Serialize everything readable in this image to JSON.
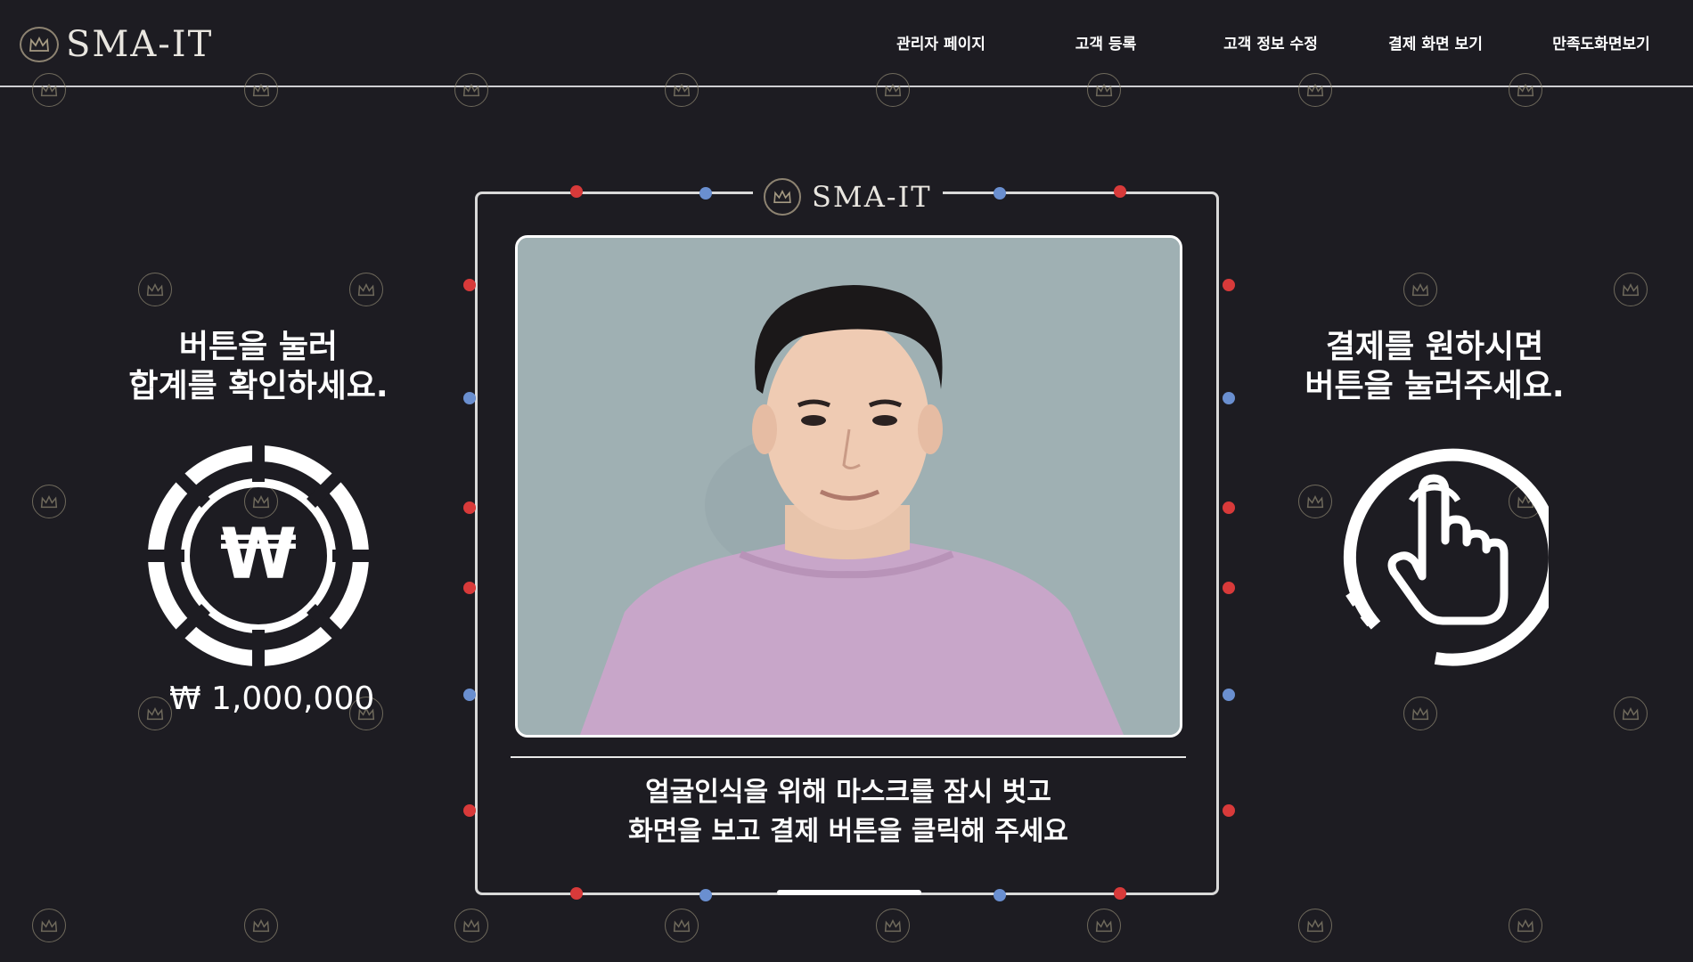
{
  "header": {
    "logo_text": "SMA-IT",
    "nav": [
      {
        "label": "관리자 페이지"
      },
      {
        "label": "고객 등록"
      },
      {
        "label": "고객 정보 수정"
      },
      {
        "label": "결제 화면 보기"
      },
      {
        "label": "만족도화면보기"
      }
    ]
  },
  "left_panel": {
    "title_line1": "버튼을 눌러",
    "title_line2": "합계를 확인하세요.",
    "icon": "won-coin-icon",
    "amount": "₩ 1,000,000"
  },
  "right_panel": {
    "title_line1": "결제를 원하시면",
    "title_line2": "버튼을 눌러주세요.",
    "icon": "tap-hand-icon"
  },
  "center": {
    "frame_logo_text": "SMA-IT",
    "caption_line1": "얼굴인식을 위해 마스크를 잠시 벗고",
    "caption_line2": "화면을 보고 결제 버튼을 클릭해 주세요"
  },
  "colors": {
    "background": "#1d1c22",
    "crown_gold": "#8a836f",
    "accent_red": "#d83a3a",
    "accent_blue": "#6a8fd0"
  }
}
